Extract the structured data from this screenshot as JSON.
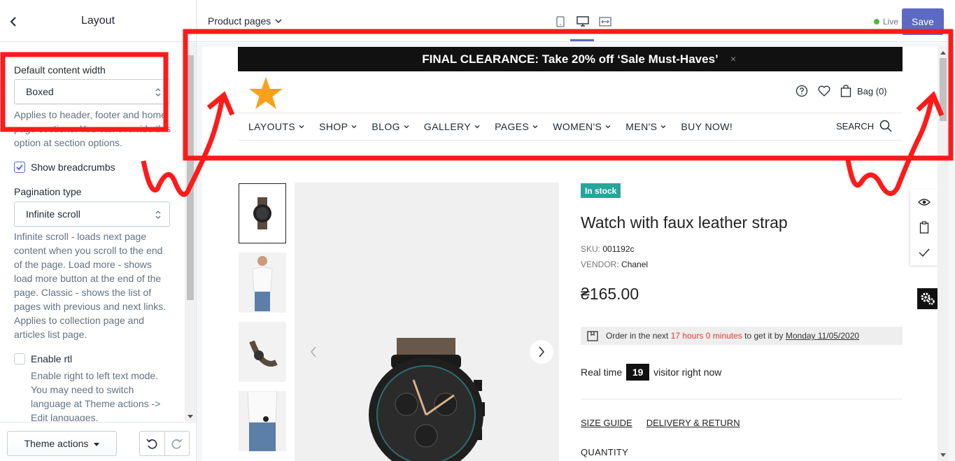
{
  "sidebar": {
    "title": "Layout",
    "content_width": {
      "label": "Default content width",
      "value": "Boxed",
      "help": "Applies to header, footer and home page sections. You can override this option at section options."
    },
    "breadcrumbs": {
      "label": "Show breadcrumbs",
      "checked": true
    },
    "pagination": {
      "label": "Pagination type",
      "value": "Infinite scroll",
      "help": "Infinite scroll - loads next page content when you scroll to the end of the page. Load more - shows load more button at the end of the page. Classic - shows the list of pages with previous and next links. Applies to collection page and articles list page."
    },
    "rtl": {
      "label": "Enable rtl",
      "checked": false,
      "help": "Enable right to left text mode. You may need to switch language at Theme actions -> Edit languages."
    },
    "footer": {
      "theme_actions": "Theme actions"
    }
  },
  "topbar": {
    "page_selector": "Product pages",
    "status": "Live",
    "status_color": "#50b83c",
    "save": "Save",
    "accent": "#5c6ac4"
  },
  "store": {
    "announcement": "FINAL CLEARANCE: Take 20% off ‘Sale Must-Haves’",
    "close": "×",
    "bag": "Bag (0)",
    "nav": [
      "LAYOUTS",
      "SHOP",
      "BLOG",
      "GALLERY",
      "PAGES",
      "WOMEN'S",
      "MEN'S",
      "BUY NOW!"
    ],
    "search": "SEARCH",
    "product": {
      "badge": "In stock",
      "title": "Watch with faux leather strap",
      "sku_label": "SKU:",
      "sku": "001192c",
      "vendor_label": "VENDOR:",
      "vendor": "Chanel",
      "price": "₴165.00",
      "order_prefix": "Order in the next",
      "order_time": "17 hours 0 minutes",
      "order_mid": "to get it by",
      "order_date": "Monday 11/05/2020",
      "realtime_prefix": "Real time",
      "realtime_count": "19",
      "realtime_suffix": "visitor right now",
      "size_guide": "SIZE GUIDE",
      "delivery": "DELIVERY & RETURN",
      "quantity": "QUANTITY"
    }
  }
}
